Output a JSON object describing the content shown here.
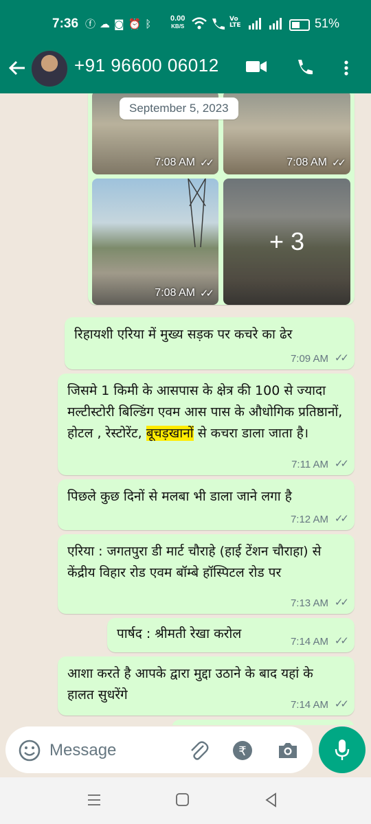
{
  "status_bar": {
    "time": "7:36",
    "battery_percent": "51%",
    "battery_level": 0.51,
    "icons": [
      "facebook-icon",
      "cloud-icon",
      "instagram-icon",
      "alarm-icon",
      "bluetooth-icon",
      "data-speed-icon",
      "wifi-icon",
      "wifi-call-icon",
      "volte-icon",
      "signal-icon",
      "signal-icon",
      "battery-icon"
    ],
    "net_speed": "0.00",
    "net_speed_unit": "KB/S"
  },
  "header": {
    "contact_name": "+91 96600 06012",
    "colors": {
      "bar": "#008069"
    }
  },
  "chat": {
    "date_chip": "September 5, 2023",
    "photos": [
      {
        "time": "7:08 AM"
      },
      {
        "time": "7:08 AM"
      },
      {
        "time": "7:08 AM"
      },
      {
        "time": "",
        "more_count": "+ 3"
      }
    ],
    "messages": [
      {
        "text": "रिहायशी एरिया में मुख्य सड़क पर कचरे का ढेर",
        "time": "7:09 AM"
      },
      {
        "text_before": "जिसमे 1 किमी के आसपास के क्षेत्र की 100 से ज्यादा मल्टीस्टोरी बिल्डिंग एवम आस पास के औधोगिक प्रतिष्ठानों, होटल , रेस्टोरेंट, ",
        "highlight": "बूचड़खानों",
        "text_after": " से कचरा डाला जाता है।",
        "time": "7:11 AM"
      },
      {
        "text": "पिछले कुछ दिनों से मलबा भी डाला जाने लगा है",
        "time": "7:12 AM"
      },
      {
        "text": "एरिया : जगतपुरा डी मार्ट चौराहे (हाई टेंशन चौराहा)  से केंद्रीय विहार रोड एवम बॉम्बे हॉस्पिटल रोड पर",
        "time": "7:13 AM"
      },
      {
        "text": "पार्षद :  श्रीमती रेखा करोल",
        "time": "7:14 AM"
      },
      {
        "text": "आशा करते है आपके द्वारा मुद्दा उठाने के बाद यहां के हालत सुधरेंगे",
        "time": "7:14 AM"
      }
    ],
    "bubble_color": "#d9fdd3",
    "wallpaper_color": "#efe7dd"
  },
  "composer": {
    "placeholder": "Message",
    "accent": "#00a884"
  }
}
